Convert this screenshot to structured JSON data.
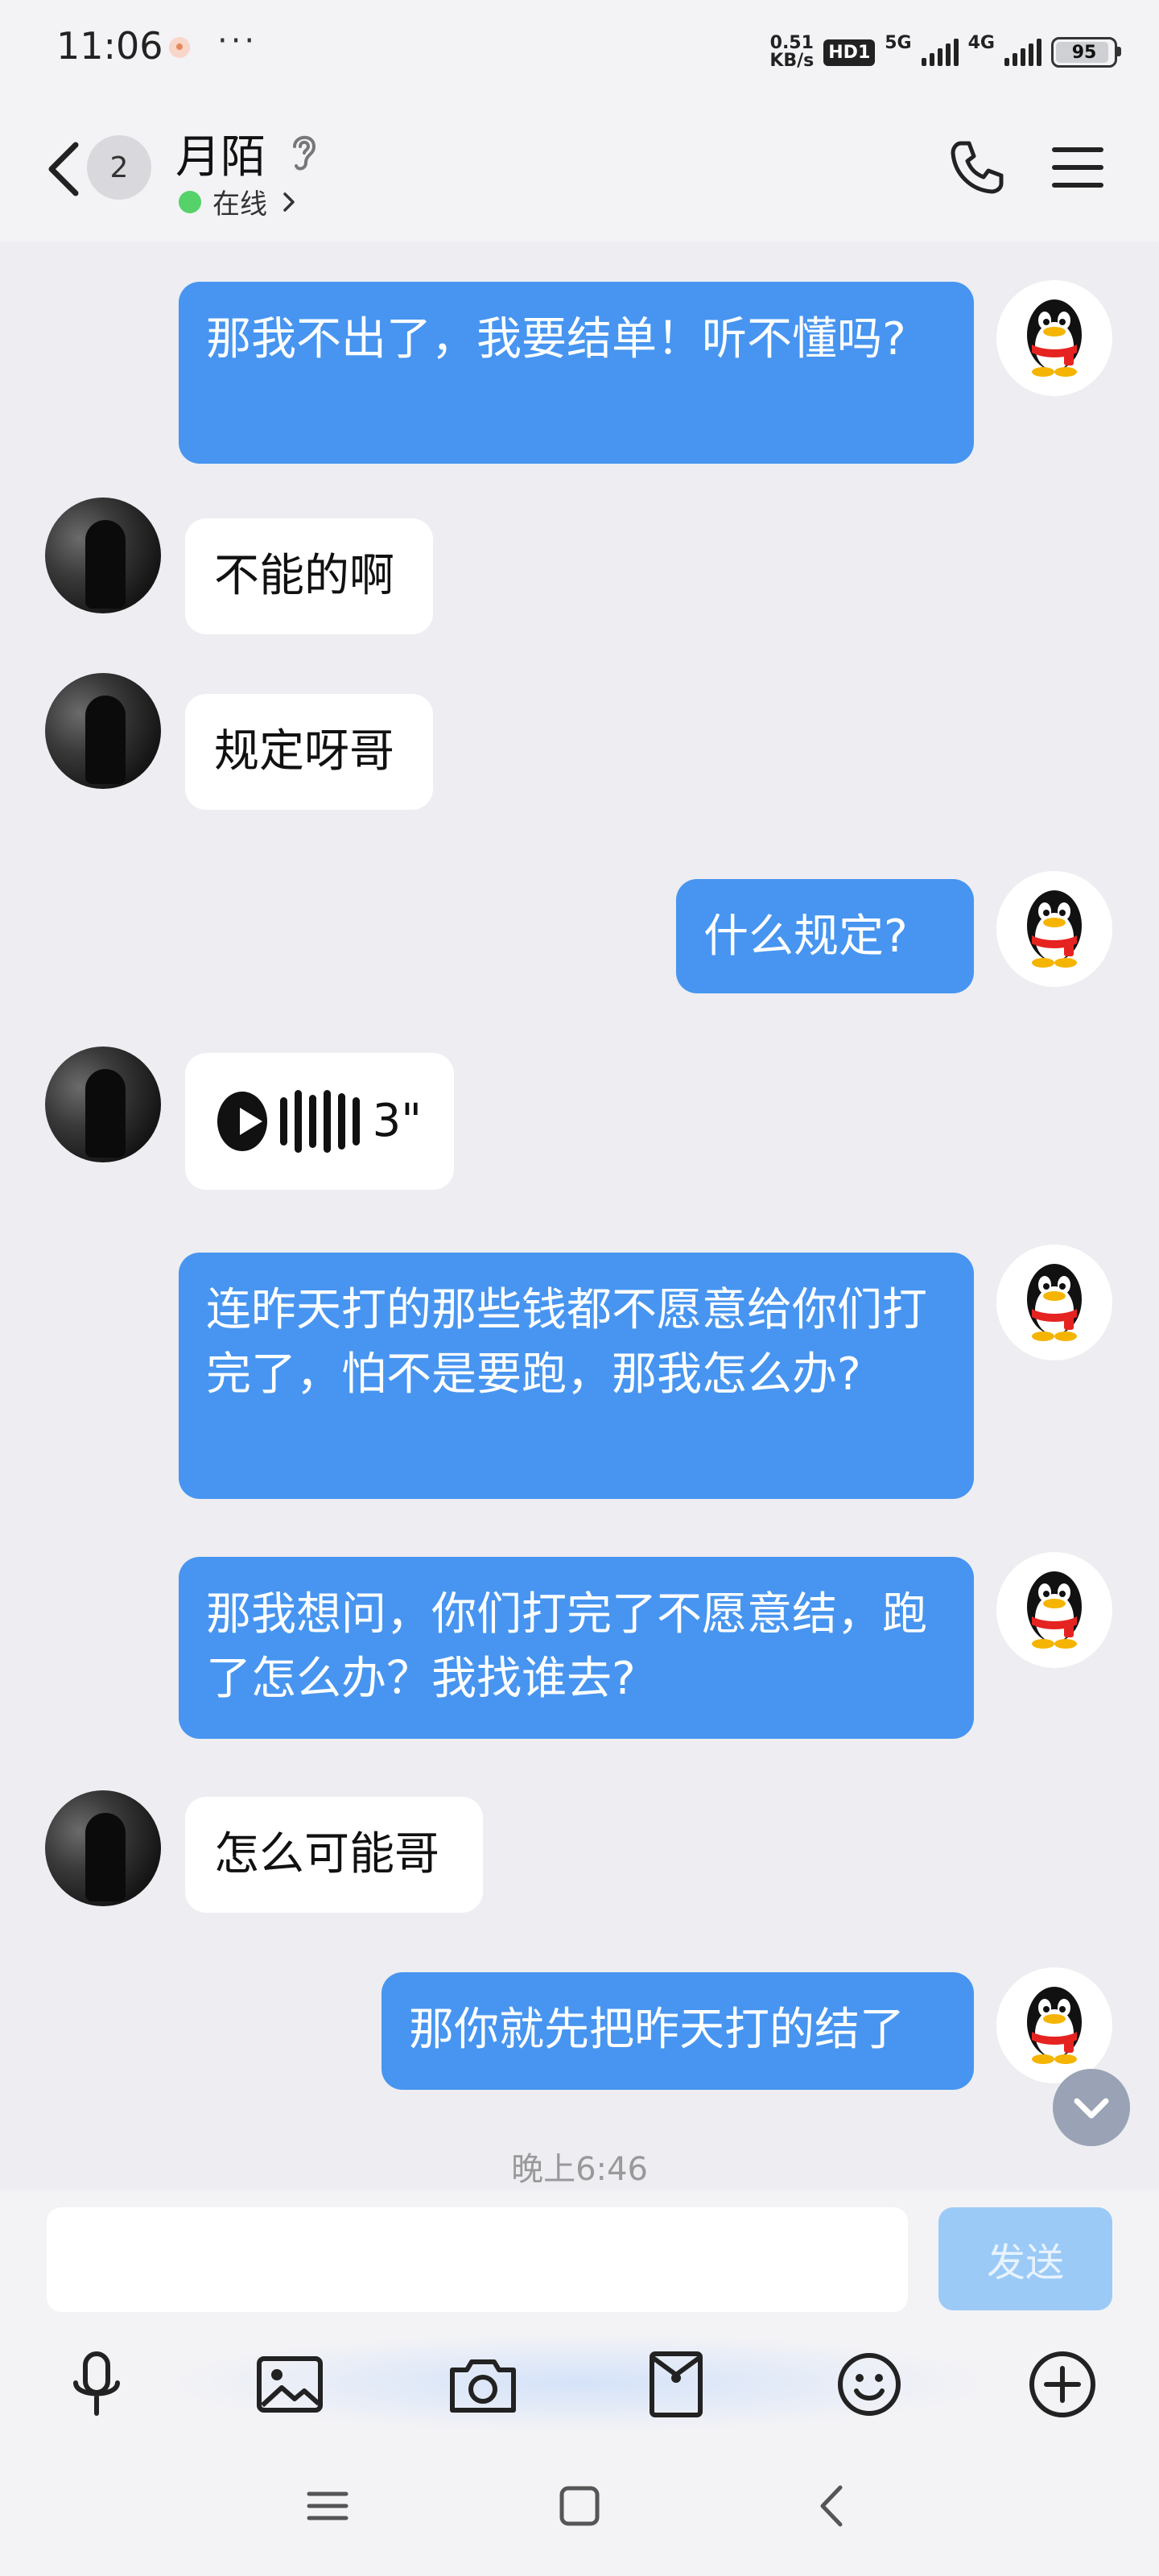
{
  "status_bar": {
    "time": "11:06",
    "more": "···",
    "net_speed_value": "0.51",
    "net_speed_unit": "KB/s",
    "hd_badge": "HD1",
    "net_5g": "5G",
    "net_4g": "4G",
    "battery": "95"
  },
  "header": {
    "unread_count": "2",
    "contact_name": "月陌",
    "status": "在线",
    "icons": [
      "back-icon",
      "ear-icon",
      "phone-icon",
      "menu-icon"
    ]
  },
  "messages": [
    {
      "from": "me",
      "type": "text",
      "text": "那我不出了，我要结单！听不懂吗?"
    },
    {
      "from": "them",
      "type": "text",
      "text": "不能的啊"
    },
    {
      "from": "them",
      "type": "text",
      "text": "规定呀哥"
    },
    {
      "from": "me",
      "type": "text",
      "text": "什么规定?"
    },
    {
      "from": "them",
      "type": "voice",
      "text": "3\""
    },
    {
      "from": "me",
      "type": "text",
      "text": "连昨天打的那些钱都不愿意给你们打完了，怕不是要跑，那我怎么办?"
    },
    {
      "from": "me",
      "type": "text",
      "text": "那我想问，你们打完了不愿意结，跑了怎么办？我找谁去?"
    },
    {
      "from": "them",
      "type": "text",
      "text": "怎么可能哥"
    },
    {
      "from": "me",
      "type": "text",
      "text": "那你就先把昨天打的结了"
    }
  ],
  "timestamp": "晚上6:46",
  "composer": {
    "input_value": "",
    "send_label": "发送"
  },
  "toolbar_icons": [
    "mic-icon",
    "image-icon",
    "camera-icon",
    "red-packet-icon",
    "emoji-icon",
    "plus-icon"
  ],
  "nav_icons": [
    "recent-apps-icon",
    "home-icon",
    "back-nav-icon"
  ],
  "colors": {
    "background": "#ededf2",
    "outgoing_bubble": "#4795f0",
    "incoming_bubble": "#ffffff",
    "online_dot": "#55d26a",
    "send_button": "#9ccaf7"
  }
}
